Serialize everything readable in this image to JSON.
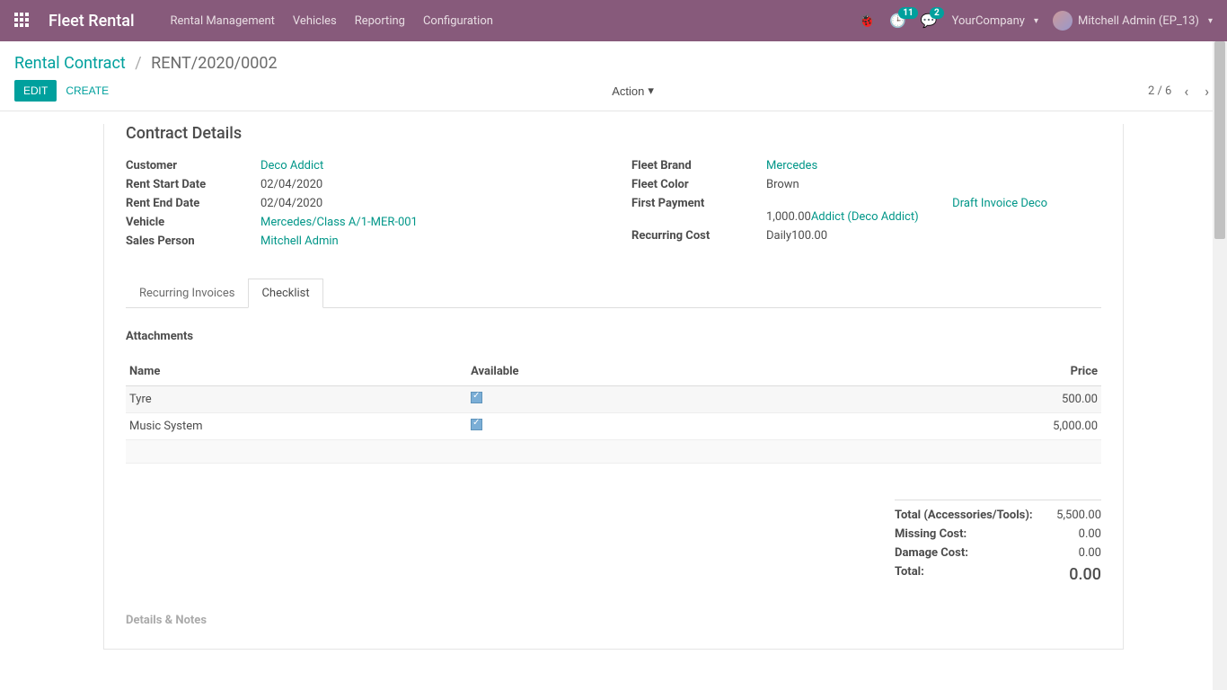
{
  "topbar": {
    "brand": "Fleet Rental",
    "menu": [
      "Rental Management",
      "Vehicles",
      "Reporting",
      "Configuration"
    ],
    "activity_count": "11",
    "discuss_count": "2",
    "company": "YourCompany",
    "user": "Mitchell Admin (EP_13)"
  },
  "breadcrumb": {
    "root": "Rental Contract",
    "current": "RENT/2020/0002"
  },
  "controls": {
    "edit": "EDIT",
    "create": "CREATE",
    "action": "Action",
    "pager": "2 / 6"
  },
  "section_title": "Contract Details",
  "left_fields": {
    "customer_label": "Customer",
    "customer_value": "Deco Addict",
    "start_label": "Rent Start Date",
    "start_value": "02/04/2020",
    "end_label": "Rent End Date",
    "end_value": "02/04/2020",
    "vehicle_label": "Vehicle",
    "vehicle_value": "Mercedes/Class A/1-MER-001",
    "sales_label": "Sales Person",
    "sales_value": "Mitchell Admin"
  },
  "right_fields": {
    "brand_label": "Fleet Brand",
    "brand_value": "Mercedes",
    "color_label": "Fleet Color",
    "color_value": "Brown",
    "first_payment_label": "First Payment",
    "first_payment_amount": "1,000.00",
    "first_payment_link1": "Draft Invoice ",
    "first_payment_link2": "Deco Addict (Deco Addict)",
    "recurring_label": "Recurring Cost",
    "recurring_value": "Daily100.00"
  },
  "tabs": {
    "recurring": "Recurring Invoices",
    "checklist": "Checklist"
  },
  "attachments": {
    "title": "Attachments",
    "headers": {
      "name": "Name",
      "available": "Available",
      "price": "Price"
    },
    "rows": [
      {
        "name": "Tyre",
        "available": true,
        "price": "500.00"
      },
      {
        "name": "Music System",
        "available": true,
        "price": "5,000.00"
      }
    ]
  },
  "totals": {
    "accessories_label": "Total (Accessories/Tools):",
    "accessories_value": "5,500.00",
    "missing_label": "Missing Cost:",
    "missing_value": "0.00",
    "damage_label": "Damage Cost:",
    "damage_value": "0.00",
    "total_label": "Total:",
    "total_value": "0.00"
  },
  "details_notes": "Details & Notes"
}
